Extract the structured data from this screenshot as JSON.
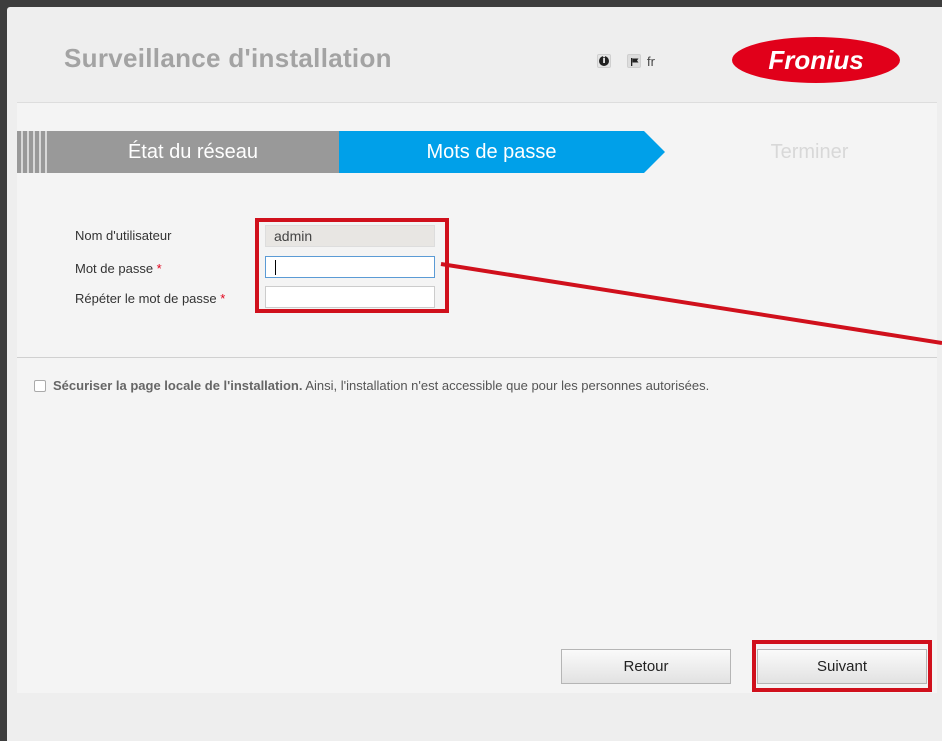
{
  "header": {
    "title": "Surveillance d'installation",
    "lang": "fr",
    "info_glyph": "i",
    "logo_text": "Fronius",
    "brand_color": "#e1001a"
  },
  "steps": [
    {
      "label": "État du réseau",
      "state": "completed",
      "color": "#999999"
    },
    {
      "label": "Mots de passe",
      "state": "active",
      "color": "#00a0e9"
    },
    {
      "label": "Terminer",
      "state": "upcoming",
      "color": "#d8d8d8"
    }
  ],
  "form": {
    "username_label": "Nom d'utilisateur",
    "username_value": "admin",
    "password_label": "Mot de passe",
    "repeat_label": "Répéter le mot de passe",
    "required_mark": "*"
  },
  "secure": {
    "bold": "Sécuriser la page locale de l'installation.",
    "text": " Ainsi, l'installation n'est accessible que pour les personnes autorisées.",
    "checked": false
  },
  "buttons": {
    "back": "Retour",
    "next": "Suivant"
  },
  "annotation_color": "#d0101c",
  "icons": [
    "info-icon",
    "flag-icon",
    "fronius-logo"
  ]
}
